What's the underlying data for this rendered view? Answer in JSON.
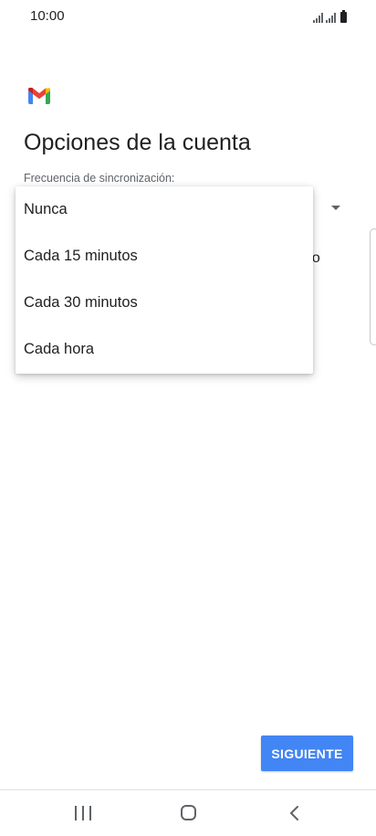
{
  "status_bar": {
    "time": "10:00",
    "icons": [
      "signal-icon",
      "signal-icon",
      "battery-icon"
    ]
  },
  "app": {
    "logo_icon": "gmail-logo-icon",
    "colors": {
      "gmail_red": "#ea4335",
      "gmail_blue": "#4285f4",
      "gmail_green": "#34a853",
      "gmail_yellow": "#fbbc04"
    }
  },
  "page": {
    "title": "Opciones de la cuenta",
    "sync_label": "Frecuencia de sincronización:",
    "partial_text": "eo"
  },
  "dropdown": {
    "arrow_icon": "dropdown-arrow-icon",
    "options": [
      {
        "label": "Nunca"
      },
      {
        "label": "Cada 15 minutos"
      },
      {
        "label": "Cada 30 minutos"
      },
      {
        "label": "Cada hora"
      }
    ]
  },
  "actions": {
    "next_label": "SIGUIENTE",
    "next_color": "#4285f4"
  },
  "nav_bar": {
    "recents_icon": "recents-icon",
    "home_icon": "home-icon",
    "back_icon": "back-icon"
  }
}
